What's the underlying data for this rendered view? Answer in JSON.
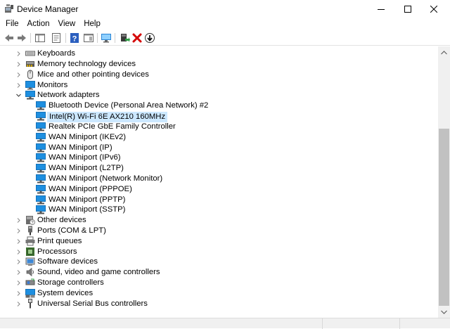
{
  "window": {
    "title": "Device Manager",
    "icon": "device-manager-icon"
  },
  "menu": [
    "File",
    "Action",
    "View",
    "Help"
  ],
  "toolbar": [
    {
      "name": "back-button",
      "icon": "arrow-left-icon"
    },
    {
      "name": "forward-button",
      "icon": "arrow-right-icon"
    },
    {
      "name": "show-hide-console-tree-button",
      "icon": "console-tree-icon"
    },
    {
      "name": "properties-button",
      "icon": "properties-icon"
    },
    {
      "name": "help-button",
      "icon": "help-icon"
    },
    {
      "name": "action-pane-button",
      "icon": "action-pane-icon"
    },
    {
      "name": "scan-hardware-button",
      "icon": "monitor-scan-icon"
    },
    {
      "name": "update-driver-button",
      "icon": "update-driver-icon"
    },
    {
      "name": "uninstall-device-button",
      "icon": "red-x-icon"
    },
    {
      "name": "enable-device-button",
      "icon": "down-arrow-circle-icon"
    }
  ],
  "tree": {
    "top_categories": [
      {
        "label": "Keyboards",
        "icon": "keyboard-icon"
      },
      {
        "label": "Memory technology devices",
        "icon": "memory-icon"
      },
      {
        "label": "Mice and other pointing devices",
        "icon": "mouse-icon"
      },
      {
        "label": "Monitors",
        "icon": "monitor-icon"
      }
    ],
    "expanded_category": {
      "label": "Network adapters",
      "icon": "network-icon",
      "expanded": true
    },
    "network_adapters": [
      {
        "label": "Bluetooth Device (Personal Area Network) #2",
        "selected": false
      },
      {
        "label": "Intel(R) Wi-Fi 6E AX210 160MHz",
        "selected": true
      },
      {
        "label": "Realtek PCIe GbE Family Controller",
        "selected": false
      },
      {
        "label": "WAN Miniport (IKEv2)",
        "selected": false
      },
      {
        "label": "WAN Miniport (IP)",
        "selected": false
      },
      {
        "label": "WAN Miniport (IPv6)",
        "selected": false
      },
      {
        "label": "WAN Miniport (L2TP)",
        "selected": false
      },
      {
        "label": "WAN Miniport (Network Monitor)",
        "selected": false
      },
      {
        "label": "WAN Miniport (PPPOE)",
        "selected": false
      },
      {
        "label": "WAN Miniport (PPTP)",
        "selected": false
      },
      {
        "label": "WAN Miniport (SSTP)",
        "selected": false
      }
    ],
    "bottom_categories": [
      {
        "label": "Other devices",
        "icon": "other-devices-icon"
      },
      {
        "label": "Ports (COM & LPT)",
        "icon": "port-icon"
      },
      {
        "label": "Print queues",
        "icon": "printer-icon"
      },
      {
        "label": "Processors",
        "icon": "processor-icon"
      },
      {
        "label": "Software devices",
        "icon": "software-device-icon"
      },
      {
        "label": "Sound, video and game controllers",
        "icon": "speaker-icon"
      },
      {
        "label": "Storage controllers",
        "icon": "storage-icon"
      },
      {
        "label": "System devices",
        "icon": "system-device-icon"
      },
      {
        "label": "Universal Serial Bus controllers",
        "icon": "usb-icon"
      }
    ]
  },
  "colors": {
    "selection": "#cce8ff",
    "network_blue": "#1e8fe0",
    "scroll_thumb": "#c1c1c1"
  }
}
